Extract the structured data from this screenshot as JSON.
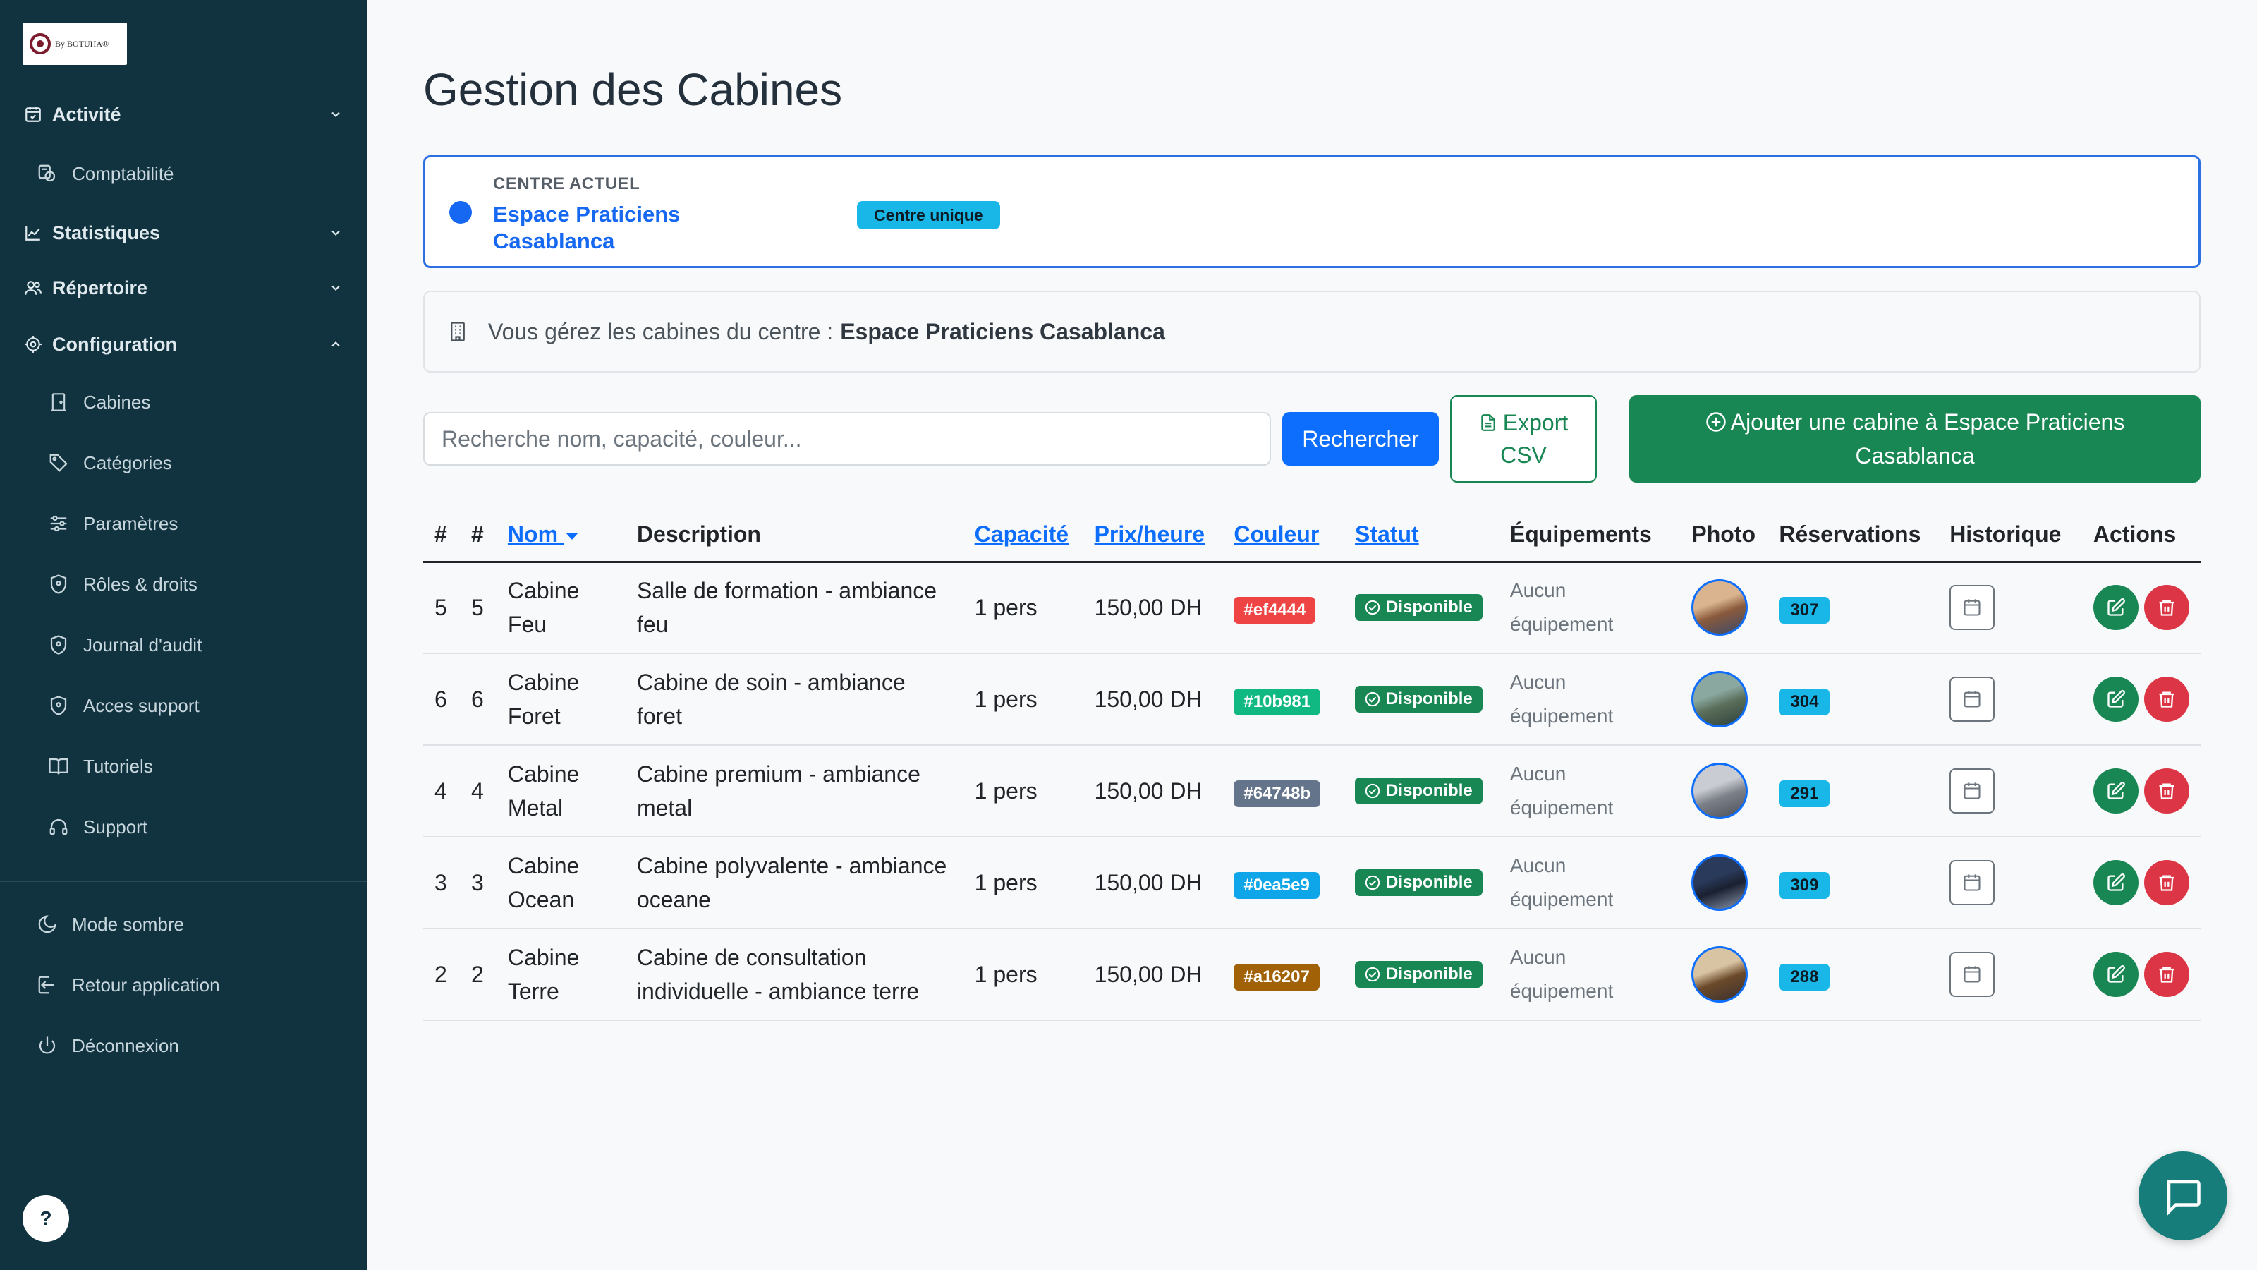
{
  "sidebar": {
    "logo_text": "By BOTUHA®",
    "sections": [
      {
        "label": "Activité",
        "icon": "calendar-check-icon"
      },
      {
        "label": "Comptabilité",
        "icon": "coins-icon"
      },
      {
        "label": "Statistiques",
        "icon": "chart-line-icon"
      },
      {
        "label": "Répertoire",
        "icon": "users-icon"
      },
      {
        "label": "Configuration",
        "icon": "gear-icon"
      }
    ],
    "config_items": [
      {
        "label": "Cabines",
        "icon": "door-icon"
      },
      {
        "label": "Catégories",
        "icon": "tag-icon"
      },
      {
        "label": "Paramètres",
        "icon": "sliders-icon"
      },
      {
        "label": "Rôles & droits",
        "icon": "shield-icon"
      },
      {
        "label": "Journal d'audit",
        "icon": "shield-icon"
      },
      {
        "label": "Acces support",
        "icon": "shield-icon"
      },
      {
        "label": "Tutoriels",
        "icon": "book-icon"
      },
      {
        "label": "Support",
        "icon": "headset-icon"
      }
    ],
    "bottom_items": [
      {
        "label": "Mode sombre",
        "icon": "moon-icon"
      },
      {
        "label": "Retour application",
        "icon": "exit-icon"
      },
      {
        "label": "Déconnexion",
        "icon": "power-icon"
      }
    ],
    "help_label": "?"
  },
  "page": {
    "title": "Gestion des Cabines"
  },
  "centre": {
    "caption": "CENTRE ACTUEL",
    "name": "Espace Praticiens Casablanca",
    "badge": "Centre unique"
  },
  "info": {
    "text": "Vous gérez les cabines du centre :",
    "centre_name": "Espace Praticiens Casablanca"
  },
  "toolbar": {
    "search_placeholder": "Recherche nom, capacité, couleur...",
    "search_button": "Rechercher",
    "export_line1": "Export",
    "export_line2": "CSV",
    "add_button": "Ajouter une cabine à Espace Praticiens Casablanca"
  },
  "table": {
    "headers": [
      "#",
      "#",
      "Nom",
      "Description",
      "Capacité",
      "Prix/heure",
      "Couleur",
      "Statut",
      "Équipements",
      "Photo",
      "Réservations",
      "Historique",
      "Actions"
    ],
    "rows": [
      {
        "id1": "5",
        "id2": "5",
        "nom": "Cabine Feu",
        "description": "Salle de formation - ambiance feu",
        "capacite": "1 pers",
        "prix": "150,00 DH",
        "couleur": "#ef4444",
        "statut": "Disponible",
        "equipements": "Aucun équipement",
        "reservations": "307"
      },
      {
        "id1": "6",
        "id2": "6",
        "nom": "Cabine Foret",
        "description": "Cabine de soin - ambiance foret",
        "capacite": "1 pers",
        "prix": "150,00 DH",
        "couleur": "#10b981",
        "statut": "Disponible",
        "equipements": "Aucun équipement",
        "reservations": "304"
      },
      {
        "id1": "4",
        "id2": "4",
        "nom": "Cabine Metal",
        "description": "Cabine premium - ambiance metal",
        "capacite": "1 pers",
        "prix": "150,00 DH",
        "couleur": "#64748b",
        "statut": "Disponible",
        "equipements": "Aucun équipement",
        "reservations": "291"
      },
      {
        "id1": "3",
        "id2": "3",
        "nom": "Cabine Ocean",
        "description": "Cabine polyvalente - ambiance oceane",
        "capacite": "1 pers",
        "prix": "150,00 DH",
        "couleur": "#0ea5e9",
        "statut": "Disponible",
        "equipements": "Aucun équipement",
        "reservations": "309"
      },
      {
        "id1": "2",
        "id2": "2",
        "nom": "Cabine Terre",
        "description": "Cabine de consultation individuelle - ambiance terre",
        "capacite": "1 pers",
        "prix": "150,00 DH",
        "couleur": "#a16207",
        "statut": "Disponible",
        "equipements": "Aucun équipement",
        "reservations": "288"
      }
    ]
  },
  "colors": {
    "sidebar_bg": "#10333f",
    "primary": "#0d6efd",
    "success": "#198754",
    "danger": "#dc3545",
    "info": "#19b7e8"
  }
}
